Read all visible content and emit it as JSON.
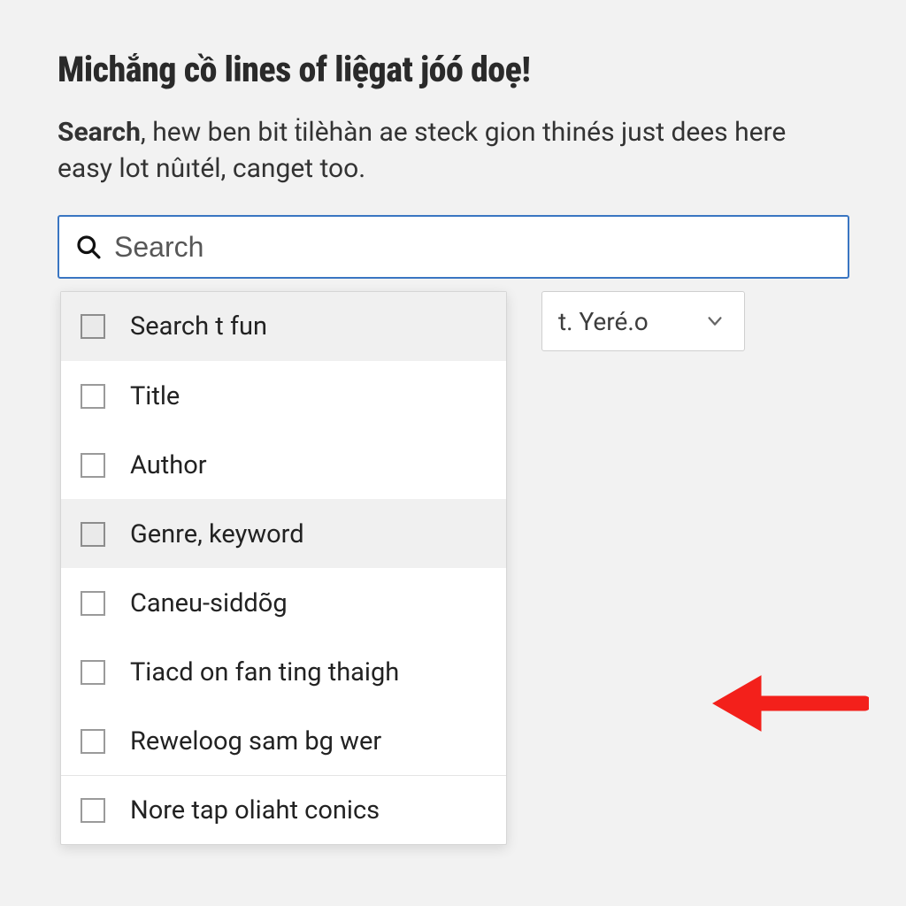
{
  "title": "Michắng cồ lines of liệgat jóó doẹ!",
  "subtitle_lead": "Search",
  "subtitle_rest": ", hew ben bit ṫilèhàn ae steck gion thinés just dees here easy lot nûıtél, canget too.",
  "search": {
    "placeholder": "Search"
  },
  "select": {
    "value": "t. Yeré.o"
  },
  "options": [
    {
      "label": "Search t fun",
      "hover": true
    },
    {
      "label": "Title",
      "hover": false
    },
    {
      "label": "Author",
      "hover": false
    },
    {
      "label": "Genre, keyword",
      "hover": true
    },
    {
      "label": "Caneu-siddõg",
      "hover": false
    },
    {
      "label": "Tiacd on fan ting thaigh",
      "hover": false
    },
    {
      "label": "Reweloog sam bg wer",
      "hover": false
    },
    {
      "label": "Nore tap oliaht conics",
      "hover": false,
      "sep": true
    }
  ]
}
